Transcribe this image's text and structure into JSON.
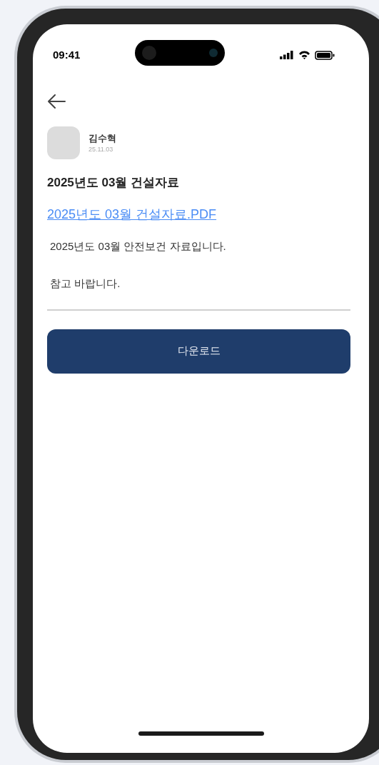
{
  "status_bar": {
    "time": "09:41"
  },
  "post": {
    "author": "김수혁",
    "date": "25.11.03",
    "title": "2025년도 03월 건설자료",
    "attachment": "2025년도 03월 건설자료.PDF",
    "body": [
      "2025년도 03월 안전보건 자료입니다.",
      "참고 바랍니다."
    ]
  },
  "download_button": {
    "label": "다운로드"
  }
}
